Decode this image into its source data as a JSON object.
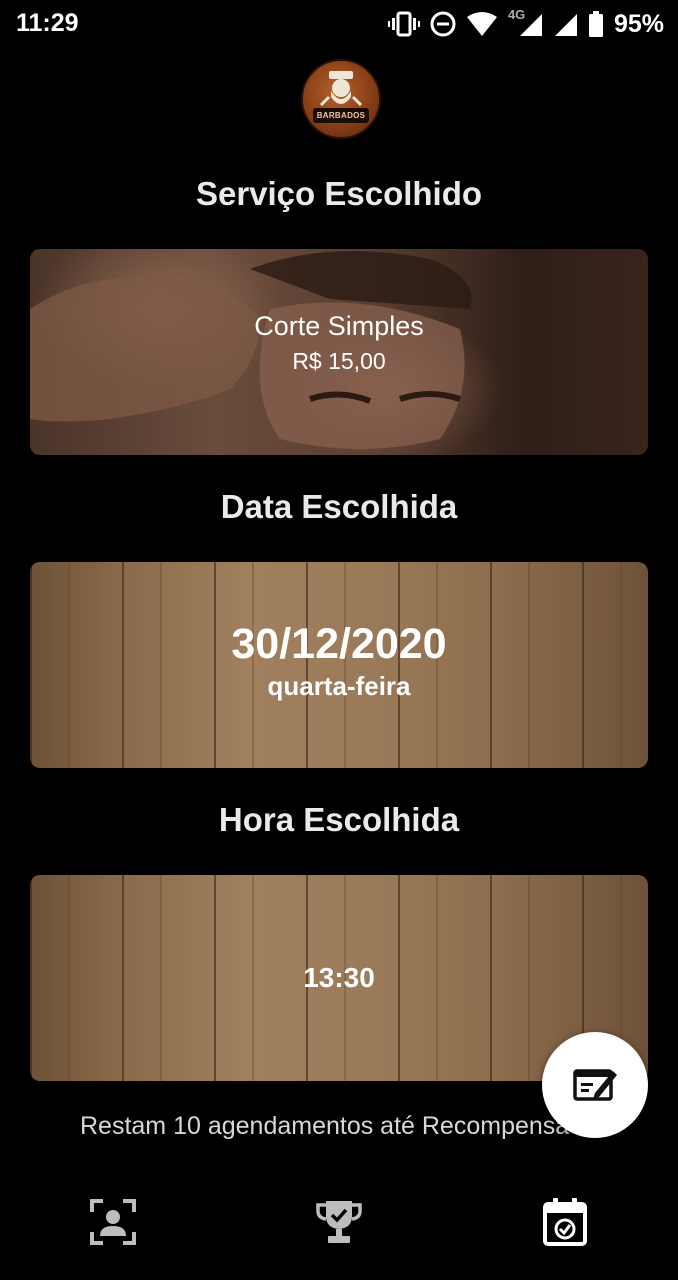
{
  "status_bar": {
    "time": "11:29",
    "network": "4G",
    "battery": "95%"
  },
  "logo": {
    "text": "BARBADOS"
  },
  "service": {
    "title": "Serviço Escolhido",
    "name": "Corte Simples",
    "price": "R$ 15,00"
  },
  "date": {
    "title": "Data Escolhida",
    "value": "30/12/2020",
    "weekday": "quarta-feira"
  },
  "time": {
    "title": "Hora Escolhida",
    "value": "13:30"
  },
  "reward_text": "Restam 10 agendamentos até Recompensa",
  "icons": {
    "fab": "edit-icon",
    "nav": [
      "profile-icon",
      "trophy-icon",
      "calendar-check-icon"
    ]
  }
}
